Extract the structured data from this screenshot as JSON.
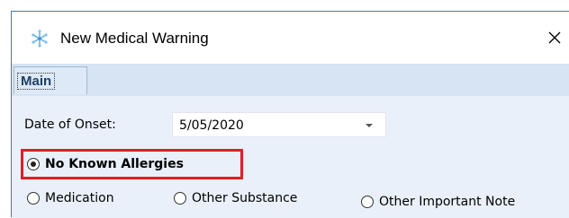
{
  "dialog": {
    "title": "New Medical Warning",
    "close_glyph": "✕",
    "icon": "snowflake-icon"
  },
  "tabs": [
    {
      "label": "Main",
      "selected": true
    }
  ],
  "form": {
    "date_of_onset": {
      "label": "Date of Onset:",
      "value": "5/05/2020"
    },
    "warning_type": {
      "options": [
        {
          "label": "No Known Allergies",
          "checked": true
        },
        {
          "label": "Medication",
          "checked": false
        },
        {
          "label": "Other Substance",
          "checked": false
        },
        {
          "label": "Other Important Note",
          "checked": false
        }
      ]
    }
  },
  "colors": {
    "window_border": "#3c7fb1",
    "panel_bg": "#e9f0f9",
    "tabstrip_bg": "#d6e4f3",
    "highlight": "#e01f26"
  }
}
